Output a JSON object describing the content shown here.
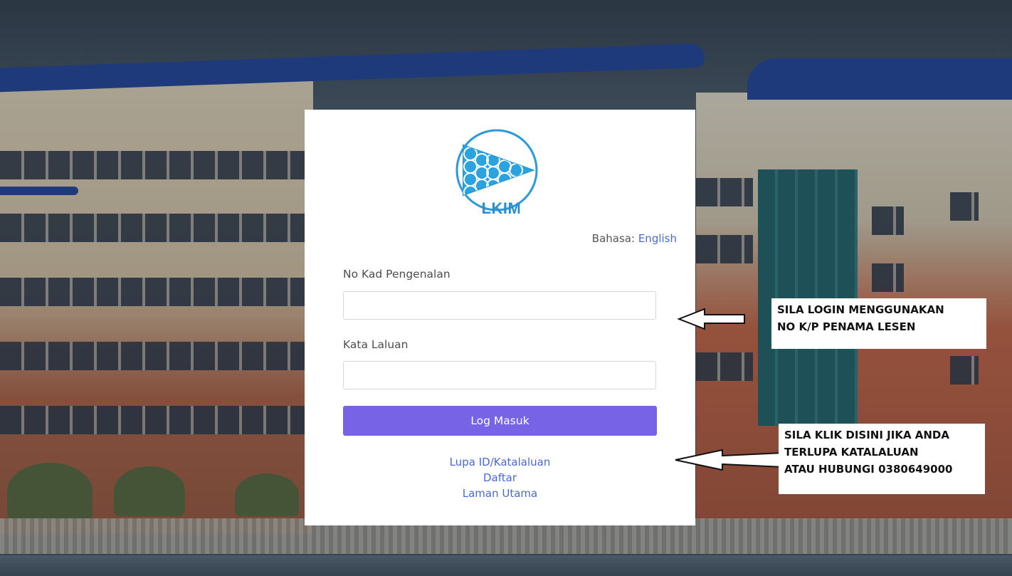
{
  "logo": {
    "text": "LKIM",
    "icon": "lkim-fish-logo-icon",
    "color": "#2a8fd0"
  },
  "language": {
    "label": "Bahasa:",
    "link": "English"
  },
  "form": {
    "id_label": "No Kad Pengenalan",
    "id_value": "",
    "password_label": "Kata Laluan",
    "password_value": "",
    "submit_label": "Log Masuk",
    "submit_color": "#7763e6"
  },
  "links": {
    "forgot": "Lupa ID/Katalaluan",
    "register": "Daftar",
    "home": "Laman Utama",
    "color": "#4a69d0"
  },
  "annotations": {
    "login_note_line1": "SILA LOGIN MENGGUNAKAN",
    "login_note_line2": "NO K/P PENAMA LESEN",
    "forgot_note_line1": "SILA KLIK DISINI JIKA ANDA",
    "forgot_note_line2": "TERLUPA KATALALUAN",
    "forgot_note_line3": "ATAU HUBUNGI 0380649000"
  }
}
